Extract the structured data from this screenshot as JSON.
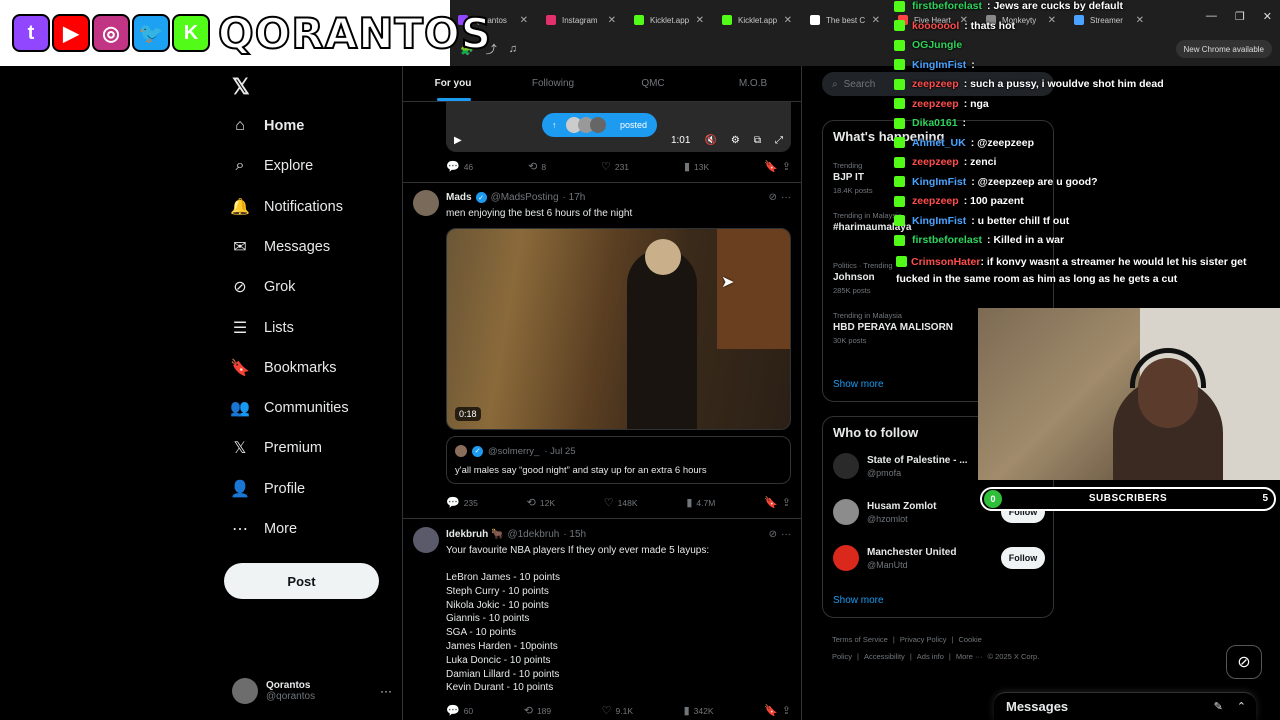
{
  "browser": {
    "tabs": [
      {
        "label": "Qorantos",
        "color": "#9146ff"
      },
      {
        "label": "Instagram",
        "color": "#e1306c"
      },
      {
        "label": "Kicklet.app",
        "color": "#53fc18"
      },
      {
        "label": "Kicklet.app",
        "color": "#53fc18"
      },
      {
        "label": "The best C",
        "color": "#ffffff"
      },
      {
        "label": "Five Heart",
        "color": "#ff4444"
      },
      {
        "label": "Monkeyty",
        "color": "#888888"
      },
      {
        "label": "Streamer",
        "color": "#4aa3ff"
      }
    ],
    "new_chrome": "New Chrome available"
  },
  "banner": {
    "name": "QORANTOS",
    "socials": [
      {
        "icon": "twitch-icon",
        "glyph": "t",
        "color": "#9146ff"
      },
      {
        "icon": "youtube-icon",
        "glyph": "▶",
        "color": "#ff0000"
      },
      {
        "icon": "instagram-icon",
        "glyph": "◎",
        "color": "#c13584"
      },
      {
        "icon": "twitter-icon",
        "glyph": "🐦",
        "color": "#1da1f2"
      },
      {
        "icon": "kick-icon",
        "glyph": "K",
        "color": "#53fc18"
      }
    ]
  },
  "nav": {
    "items": [
      {
        "label": "Home",
        "icon": "home-icon",
        "glyph": "⌂"
      },
      {
        "label": "Explore",
        "icon": "search-icon",
        "glyph": "⌕"
      },
      {
        "label": "Notifications",
        "icon": "bell-icon",
        "glyph": "🔔"
      },
      {
        "label": "Messages",
        "icon": "envelope-icon",
        "glyph": "✉"
      },
      {
        "label": "Grok",
        "icon": "grok-icon",
        "glyph": "⊘"
      },
      {
        "label": "Lists",
        "icon": "list-icon",
        "glyph": "☰"
      },
      {
        "label": "Bookmarks",
        "icon": "bookmark-icon",
        "glyph": "🔖"
      },
      {
        "label": "Communities",
        "icon": "communities-icon",
        "glyph": "👥"
      },
      {
        "label": "Premium",
        "icon": "x-icon",
        "glyph": "𝕏"
      },
      {
        "label": "Profile",
        "icon": "person-icon",
        "glyph": "👤"
      },
      {
        "label": "More",
        "icon": "more-icon",
        "glyph": "⋯"
      }
    ],
    "post_label": "Post",
    "account": {
      "name": "Qorantos",
      "handle": "@qorantos"
    }
  },
  "feed": {
    "tabs": [
      "For you",
      "Following",
      "QMC",
      "M.O.B"
    ],
    "top_video": {
      "posted": "posted",
      "time": "1:01"
    },
    "top_actions": {
      "replies": "46",
      "reposts": "8",
      "likes": "231",
      "views": "13K"
    },
    "tweet1": {
      "author": "Mads",
      "handle": "@MadsPosting",
      "time": "· 17h",
      "text": "men enjoying the best 6 hours of the night",
      "duration": "0:18",
      "quote": {
        "handle": "@solmerry_",
        "time": "· Jul 25",
        "text": "y'all males say “good night” and stay up for an extra 6 hours"
      },
      "actions": {
        "replies": "235",
        "reposts": "12K",
        "likes": "148K",
        "views": "4.7M"
      }
    },
    "tweet2": {
      "author": "Idekbruh 🐂",
      "handle": "@1dekbruh",
      "time": "· 15h",
      "text": "Your favourite NBA players If they only ever made 5 layups:",
      "lines": [
        "LeBron James - 10 points",
        "Steph Curry - 10 points",
        "Nikola Jokic - 10 points",
        "Giannis - 10 points",
        "SGA - 10 points",
        "James Harden - 10points",
        "Luka Doncic - 10 points",
        "Damian Lillard - 10 points",
        "Kevin Durant - 10 points"
      ],
      "actions": {
        "replies": "60",
        "reposts": "189",
        "likes": "9.1K",
        "views": "342K"
      }
    }
  },
  "right": {
    "search_placeholder": "Search",
    "whats_happening": "What's happening",
    "trends": [
      {
        "context": "Trending",
        "title": "BJP IT",
        "posts": "18.4K posts"
      },
      {
        "context": "Trending in Malaysia",
        "title": "#harimaumalaya",
        "posts": ""
      },
      {
        "context": "Politics · Trending",
        "title": "Johnson",
        "posts": "285K posts"
      },
      {
        "context": "Trending in Malaysia",
        "title": "HBD PERAYA MALISORN",
        "posts": "30K posts"
      }
    ],
    "show_more": "Show more",
    "who_to_follow": "Who to follow",
    "follow_suggestions": [
      {
        "name": "State of Palestine - ...",
        "handle": "@pmofa",
        "color": "#2a2a2a"
      },
      {
        "name": "Husam Zomlot",
        "handle": "@hzomlot",
        "color": "#8c8c8c"
      },
      {
        "name": "Manchester United",
        "handle": "@ManUtd",
        "color": "#da291c"
      }
    ],
    "follow_label": "Follow",
    "footer": [
      "Terms of Service",
      "|",
      "Privacy Policy",
      "|",
      "Cookie Policy",
      "|",
      "Accessibility",
      "|",
      "Ads info",
      "|",
      "More ···",
      "© 2025 X Corp."
    ]
  },
  "chat": [
    {
      "nick": "firstbeforelast",
      "color": "#2fd35b",
      "text": ": Jews are cucks by default"
    },
    {
      "nick": "kooooool",
      "color": "#ff4d4d",
      "text": ": thats hot"
    },
    {
      "nick": "OGJungle",
      "color": "#2fd35b",
      "text": ""
    },
    {
      "nick": "KingImFist",
      "color": "#4aa3ff",
      "text": ":"
    },
    {
      "nick": "zeepzeep",
      "color": "#ff4d4d",
      "text": ": such a pussy, i wouldve shot him dead"
    },
    {
      "nick": "zeepzeep",
      "color": "#ff4d4d",
      "text": ": nga"
    },
    {
      "nick": "Dika0161",
      "color": "#2fd35b",
      "text": ":"
    },
    {
      "nick": "Ahmet_UK",
      "color": "#4aa3ff",
      "text": ": @zeepzeep"
    },
    {
      "nick": "zeepzeep",
      "color": "#ff4d4d",
      "text": ": zenci"
    },
    {
      "nick": "KingImFist",
      "color": "#4aa3ff",
      "text": ": @zeepzeep are u good?"
    },
    {
      "nick": "zeepzeep",
      "color": "#ff4d4d",
      "text": ": 100 pazent"
    },
    {
      "nick": "KingImFist",
      "color": "#4aa3ff",
      "text": ": u better chill tf out"
    },
    {
      "nick": "firstbeforelast",
      "color": "#2fd35b",
      "text": ": Killed in a war"
    },
    {
      "nick": "CrimsonHater",
      "color": "#ff4d4d",
      "text": ": if konvy wasnt a streamer he would let his sister get fucked in the same room as him as long as he gets a cut"
    }
  ],
  "subscribers": {
    "label": "SUBSCRIBERS",
    "current": "0",
    "goal": "5"
  },
  "messages_drawer": {
    "title": "Messages"
  }
}
